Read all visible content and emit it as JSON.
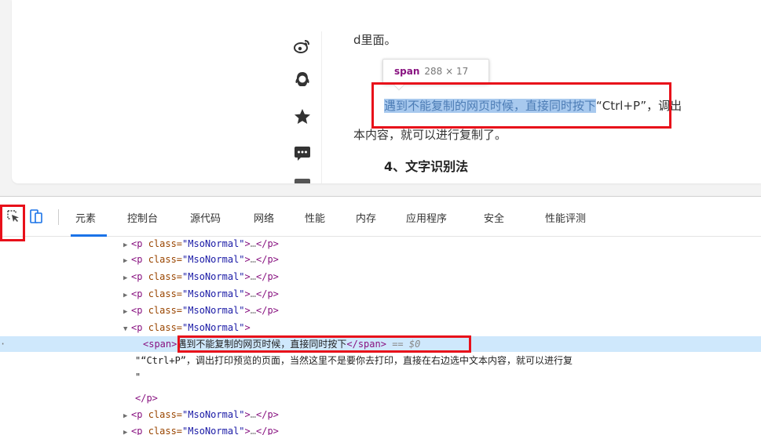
{
  "article": {
    "line1": "d里面。",
    "line2_selected": "遇到不能复制的网页时候，直接同时按下",
    "line2_rest": "“Ctrl+P”，调出",
    "line3": "本内容，就可以进行复制了。",
    "heading": "4、文字识别法"
  },
  "share_icons": [
    "weibo-icon",
    "qq-icon",
    "star-icon",
    "wechat-icon"
  ],
  "tooltip": {
    "tag": "span",
    "dims": "288 × 17"
  },
  "devtools": {
    "tabs": [
      "元素",
      "控制台",
      "源代码",
      "网络",
      "性能",
      "内存",
      "应用程序",
      "安全",
      "性能评测"
    ],
    "active_tab": "元素"
  },
  "tree": {
    "p_open": "<p",
    "p_close": "</p>",
    "attr_name": "class=",
    "attr_value": "\"MsoNormal\"",
    "ellipsis": "…",
    "span_open_tag": "<span",
    "span_text": "遇到不能复制的网页时候，直接同时按下",
    "span_close_tag": "</span",
    "span_eq": "== $0",
    "text_node": "\"“Ctrl+P”，调出打印预览的页面，当然这里不是要你去打印，直接在右边选中文本内容，就可以进行复",
    "text_node_end": "\""
  },
  "colors": {
    "highlight_red": "#e8101a",
    "selection_blue": "#a8c9ee",
    "row_selected": "#cfe8fc",
    "tag_purple": "#881280",
    "attr_orange": "#994500",
    "value_blue": "#1a1aa6"
  }
}
